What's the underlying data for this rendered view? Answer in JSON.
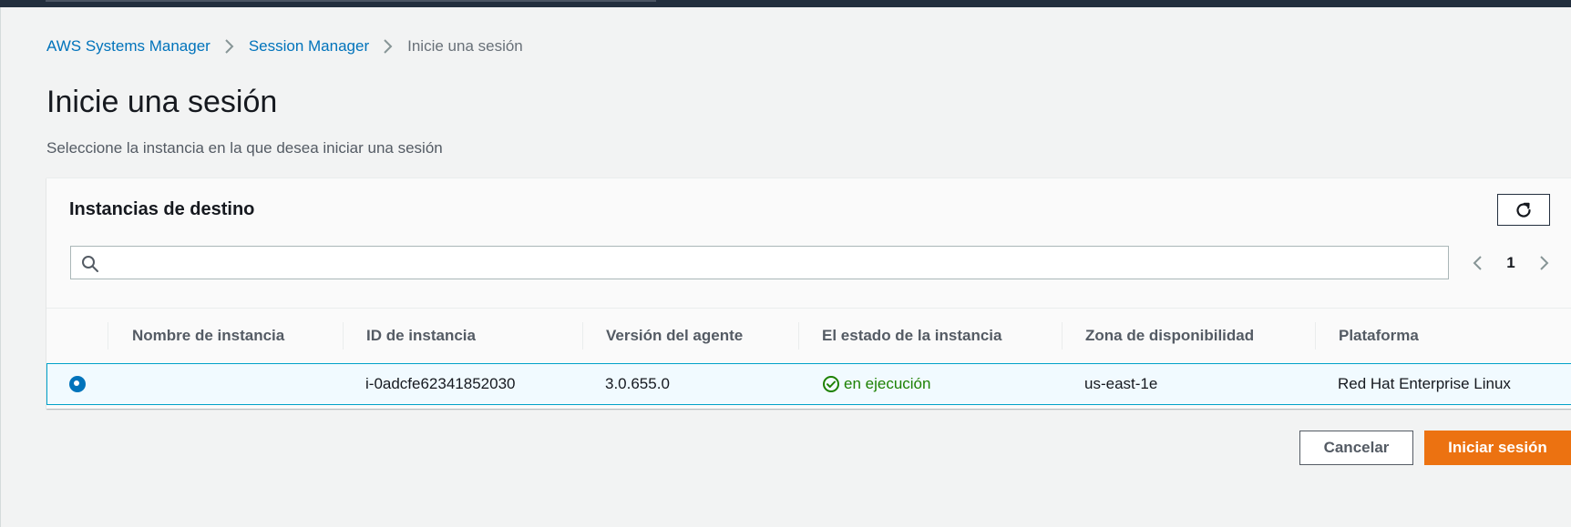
{
  "colors": {
    "link": "#0073bb",
    "primary_button": "#ec7211",
    "status_running": "#1d8102",
    "selected_row_border": "#00a1c9",
    "topbar": "#232f3e"
  },
  "breadcrumb": {
    "items": [
      "AWS Systems Manager",
      "Session Manager",
      "Inicie una sesión"
    ]
  },
  "page": {
    "title": "Inicie una sesión",
    "description": "Seleccione la instancia en la que desea iniciar una sesión"
  },
  "panel": {
    "title": "Instancias de destino",
    "refresh_icon": "refresh-icon",
    "search": {
      "value": "",
      "placeholder": "",
      "icon": "search-icon"
    },
    "pagination": {
      "current_page": "1"
    }
  },
  "table": {
    "columns": [
      "Nombre de instancia",
      "ID de instancia",
      "Versión del agente",
      "El estado de la instancia",
      "Zona de disponibilidad",
      "Plataforma"
    ],
    "rows": [
      {
        "selected": true,
        "name": "",
        "id": "i-0adcfe62341852030",
        "agent_version": "3.0.655.0",
        "state": "en ejecución",
        "state_icon": "check-circle-icon",
        "availability_zone": "us-east-1e",
        "platform": "Red Hat Enterprise Linux"
      }
    ]
  },
  "actions": {
    "cancel": "Cancelar",
    "start": "Iniciar sesión"
  }
}
